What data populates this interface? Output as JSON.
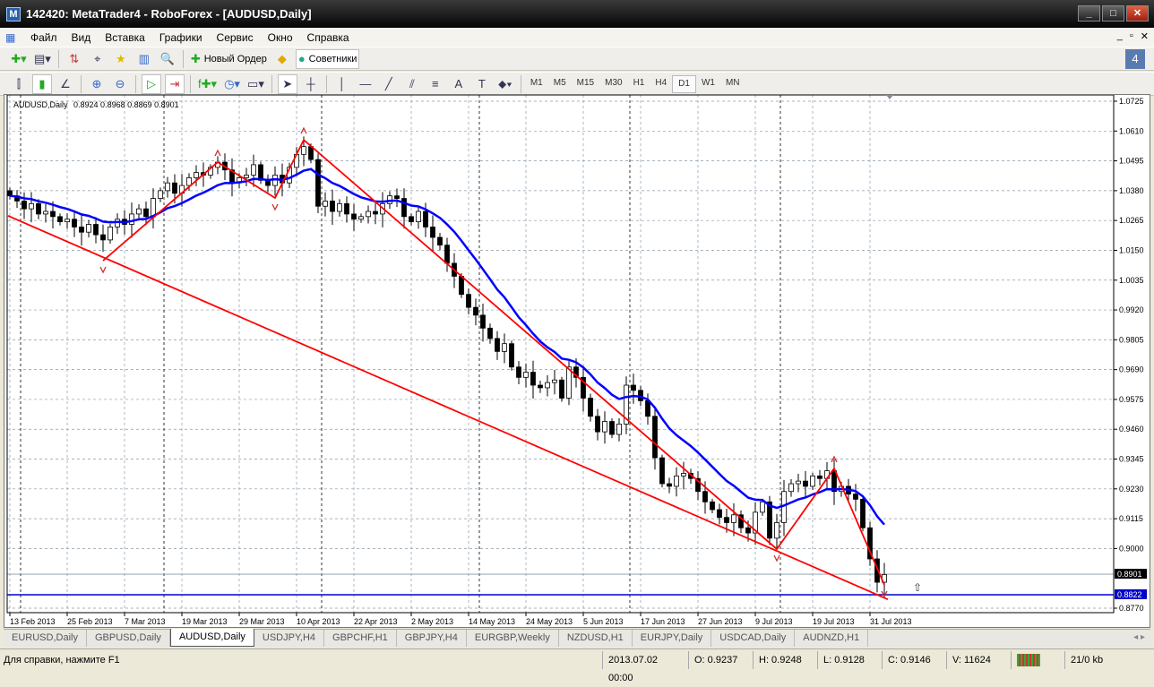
{
  "window": {
    "title": "142420: MetaTrader4 - RoboForex - [AUDUSD,Daily]",
    "min": "_",
    "max": "□",
    "close": "✕"
  },
  "menu": [
    "Файл",
    "Вид",
    "Вставка",
    "Графики",
    "Сервис",
    "Окно",
    "Справка"
  ],
  "toolbar1": {
    "new_order": "Новый Ордер",
    "experts": "Советники"
  },
  "timeframes": [
    "M1",
    "M5",
    "M15",
    "M30",
    "H1",
    "H4",
    "D1",
    "W1",
    "MN"
  ],
  "active_timeframe": "D1",
  "chart": {
    "header": "AUDUSD,Daily",
    "ohlc": "0.8924 0.8968 0.8869 0.8901",
    "current_price": "0.8901",
    "line_price": "0.8822"
  },
  "chart_data": {
    "type": "candlestick",
    "symbol": "AUDUSD",
    "period": "Daily",
    "ylim": [
      0.877,
      1.0725
    ],
    "y_ticks": [
      "1.0725",
      "1.0610",
      "1.0495",
      "1.0380",
      "1.0265",
      "1.0150",
      "1.0035",
      "0.9920",
      "0.9805",
      "0.9690",
      "0.9575",
      "0.9460",
      "0.9345",
      "0.9230",
      "0.9115",
      "0.9000",
      "0.8770"
    ],
    "x_labels": [
      "13 Feb 2013",
      "25 Feb 2013",
      "7 Mar 2013",
      "19 Mar 2013",
      "29 Mar 2013",
      "10 Apr 2013",
      "22 Apr 2013",
      "2 May 2013",
      "14 May 2013",
      "24 May 2013",
      "5 Jun 2013",
      "17 Jun 2013",
      "27 Jun 2013",
      "9 Jul 2013",
      "19 Jul 2013",
      "31 Jul 2013"
    ],
    "x_label_every_bars": 8,
    "closes": [
      1.036,
      1.034,
      1.031,
      1.033,
      1.029,
      1.03,
      1.028,
      1.026,
      1.027,
      1.024,
      1.022,
      1.025,
      1.021,
      1.019,
      1.024,
      1.027,
      1.025,
      1.029,
      1.031,
      1.028,
      1.035,
      1.038,
      1.041,
      1.037,
      1.04,
      1.043,
      1.045,
      1.044,
      1.047,
      1.049,
      1.046,
      1.041,
      1.043,
      1.044,
      1.048,
      1.042,
      1.04,
      1.044,
      1.041,
      1.047,
      1.052,
      1.055,
      1.05,
      1.032,
      1.034,
      1.03,
      1.033,
      1.029,
      1.027,
      1.028,
      1.03,
      1.029,
      1.033,
      1.036,
      1.035,
      1.028,
      1.026,
      1.03,
      1.024,
      1.02,
      1.017,
      1.01,
      1.005,
      0.998,
      0.993,
      0.99,
      0.985,
      0.981,
      0.976,
      0.979,
      0.97,
      0.966,
      0.968,
      0.963,
      0.962,
      0.964,
      0.965,
      0.958,
      0.97,
      0.966,
      0.958,
      0.951,
      0.945,
      0.949,
      0.944,
      0.948,
      0.963,
      0.961,
      0.957,
      0.951,
      0.935,
      0.925,
      0.924,
      0.928,
      0.929,
      0.927,
      0.922,
      0.918,
      0.915,
      0.912,
      0.91,
      0.913,
      0.908,
      0.906,
      0.914,
      0.918,
      0.904,
      0.91,
      0.922,
      0.925,
      0.926,
      0.924,
      0.928,
      0.927,
      0.93,
      0.922,
      0.924,
      0.921,
      0.919,
      0.908,
      0.896,
      0.887,
      0.89
    ],
    "moving_average": {
      "type": "EMA",
      "period": 13,
      "color": "#0000ff"
    },
    "zigzag": [
      [
        13,
        1.011
      ],
      [
        29,
        1.049
      ],
      [
        37,
        1.0352
      ],
      [
        41,
        1.0576
      ],
      [
        107,
        0.8998
      ],
      [
        115,
        0.9309
      ],
      [
        122,
        0.886
      ]
    ],
    "trendline": [
      [
        -0.25,
        1.0283
      ],
      [
        122.5,
        0.8804
      ]
    ],
    "hlines": [
      {
        "price": 0.8822,
        "color": "#0000cc"
      },
      {
        "price": 0.8901,
        "color": "#8899aa"
      }
    ],
    "colors": {
      "zigzag": "#ff0000",
      "ma": "#0000ff",
      "candle": "#000000"
    }
  },
  "tabs": [
    "EURUSD,Daily",
    "GBPUSD,Daily",
    "AUDUSD,Daily",
    "USDJPY,H4",
    "GBPCHF,H1",
    "GBPJPY,H4",
    "EURGBP,Weekly",
    "NZDUSD,H1",
    "EURJPY,Daily",
    "USDCAD,Daily",
    "AUDNZD,H1"
  ],
  "active_tab": "AUDUSD,Daily",
  "status": {
    "help": "Для справки, нажмите F1",
    "datetime": "2013.07.02 00:00",
    "open": "O: 0.9237",
    "high": "H: 0.9248",
    "low": "L: 0.9128",
    "close": "C: 0.9146",
    "volume": "V: 11624",
    "traffic": "21/0 kb"
  }
}
